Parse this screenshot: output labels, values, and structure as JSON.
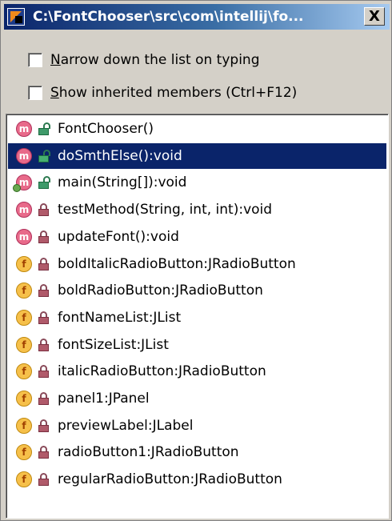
{
  "window": {
    "title": "C:\\FontChooser\\src\\com\\intellij\\fo...",
    "close_label": "X"
  },
  "options": [
    {
      "mnemonic": "N",
      "rest": "arrow down the list on typing",
      "checked": false
    },
    {
      "mnemonic": "S",
      "rest": "how inherited members (Ctrl+F12)",
      "checked": false
    }
  ],
  "members": [
    {
      "label": "FontChooser()",
      "kind": "method",
      "kind_letter": "m",
      "visibility": "public",
      "selected": false
    },
    {
      "label": "doSmthElse():void",
      "kind": "method",
      "kind_letter": "m",
      "visibility": "public",
      "selected": true
    },
    {
      "label": "main(String[]):void",
      "kind": "method",
      "kind_letter": "m",
      "visibility": "public",
      "selected": false,
      "overrides": true
    },
    {
      "label": "testMethod(String, int, int):void",
      "kind": "method",
      "kind_letter": "m",
      "visibility": "private",
      "selected": false
    },
    {
      "label": "updateFont():void",
      "kind": "method",
      "kind_letter": "m",
      "visibility": "private",
      "selected": false
    },
    {
      "label": "boldItalicRadioButton:JRadioButton",
      "kind": "field",
      "kind_letter": "f",
      "visibility": "private",
      "selected": false
    },
    {
      "label": "boldRadioButton:JRadioButton",
      "kind": "field",
      "kind_letter": "f",
      "visibility": "private",
      "selected": false
    },
    {
      "label": "fontNameList:JList",
      "kind": "field",
      "kind_letter": "f",
      "visibility": "private",
      "selected": false
    },
    {
      "label": "fontSizeList:JList",
      "kind": "field",
      "kind_letter": "f",
      "visibility": "private",
      "selected": false
    },
    {
      "label": "italicRadioButton:JRadioButton",
      "kind": "field",
      "kind_letter": "f",
      "visibility": "private",
      "selected": false
    },
    {
      "label": "panel1:JPanel",
      "kind": "field",
      "kind_letter": "f",
      "visibility": "private",
      "selected": false
    },
    {
      "label": "previewLabel:JLabel",
      "kind": "field",
      "kind_letter": "f",
      "visibility": "private",
      "selected": false
    },
    {
      "label": "radioButton1:JRadioButton",
      "kind": "field",
      "kind_letter": "f",
      "visibility": "private",
      "selected": false
    },
    {
      "label": "regularRadioButton:JRadioButton",
      "kind": "field",
      "kind_letter": "f",
      "visibility": "private",
      "selected": false
    }
  ],
  "colors": {
    "selection": "#0a246a",
    "method_icon": "#e86a8a",
    "field_icon": "#f6c04a"
  }
}
